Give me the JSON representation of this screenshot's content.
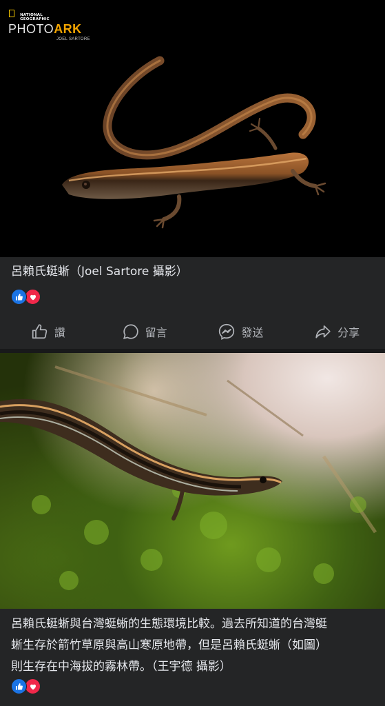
{
  "post1": {
    "watermark": {
      "brand_line1": "NATIONAL",
      "brand_line2": "GEOGRAPHIC",
      "photo": "PHOTO",
      "ark": "ARK",
      "credit": "JOEL SARTORE"
    },
    "caption": "呂賴氏蜓蜥（Joel Sartore 攝影）",
    "reactions": [
      "like",
      "love"
    ],
    "actions": [
      {
        "icon": "thumbs-up-icon",
        "label": "讚"
      },
      {
        "icon": "comment-icon",
        "label": "留言"
      },
      {
        "icon": "messenger-icon",
        "label": "發送"
      },
      {
        "icon": "share-icon",
        "label": "分享"
      }
    ]
  },
  "post2": {
    "caption": "呂賴氏蜓蜥與台灣蜓蜥的生態環境比較。過去所知道的台灣蜓\n蜥生存於箭竹草原與高山寒原地帶，但是呂賴氏蜓蜥（如圖）\n則生存在中海拔的霧林帶。（王宇德 攝影）",
    "reactions": [
      "like",
      "love"
    ]
  },
  "colors": {
    "like": "#1b74e4",
    "love": "#f0284a",
    "surface": "#242526"
  }
}
